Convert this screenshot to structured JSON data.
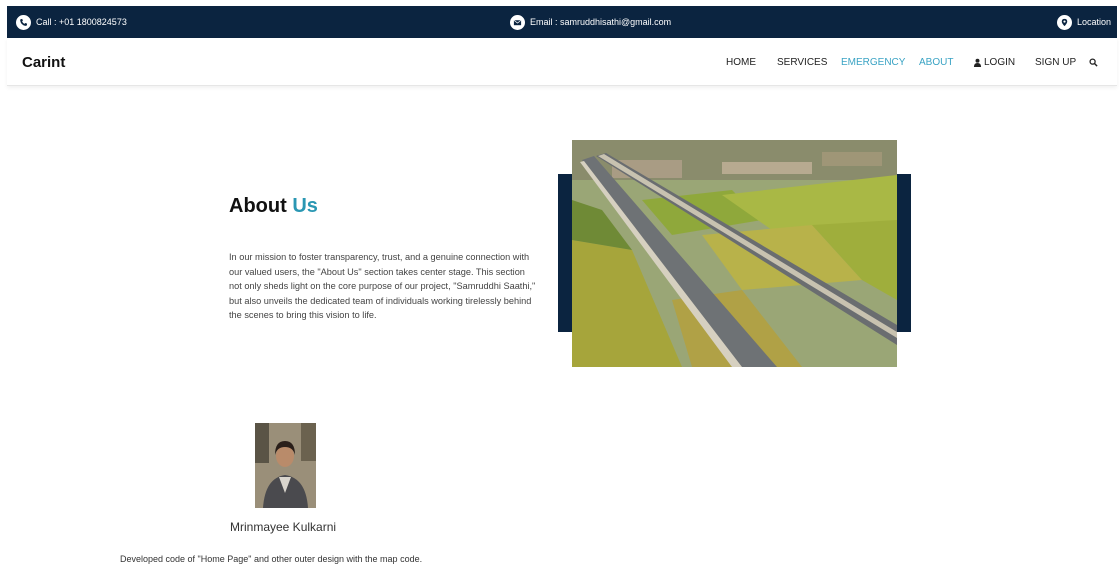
{
  "topbar": {
    "call": "Call : +01 1800824573",
    "email": "Email : samruddhisathi@gmail.com",
    "location": "Location"
  },
  "navbar": {
    "brand": "Carint",
    "links": {
      "home": "HOME",
      "services": "SERVICES",
      "emergency": "EMERGENCY",
      "about": "ABOUT",
      "login": "LOGIN",
      "signup": "SIGN UP"
    },
    "active_color": "#3aa3c4"
  },
  "about": {
    "title_main": "About",
    "title_accent": "Us",
    "paragraph": "In our mission to foster transparency, trust, and a genuine connection with our valued users, the \"About Us\" section takes center stage. This section not only sheds light on the core purpose of our project, \"Samruddhi Saathi,\" but also unveils the dedicated team of individuals working tirelessly behind the scenes to bring this vision to life.",
    "image_icon": "highway-aerial-photo"
  },
  "team": {
    "member_name": "Mrinmayee Kulkarni",
    "member_contribution": "Developed code of \"Home Page\" and other outer design with the map code."
  },
  "colors": {
    "topbar_bg": "#0b2440",
    "accent": "#2a97b3"
  }
}
